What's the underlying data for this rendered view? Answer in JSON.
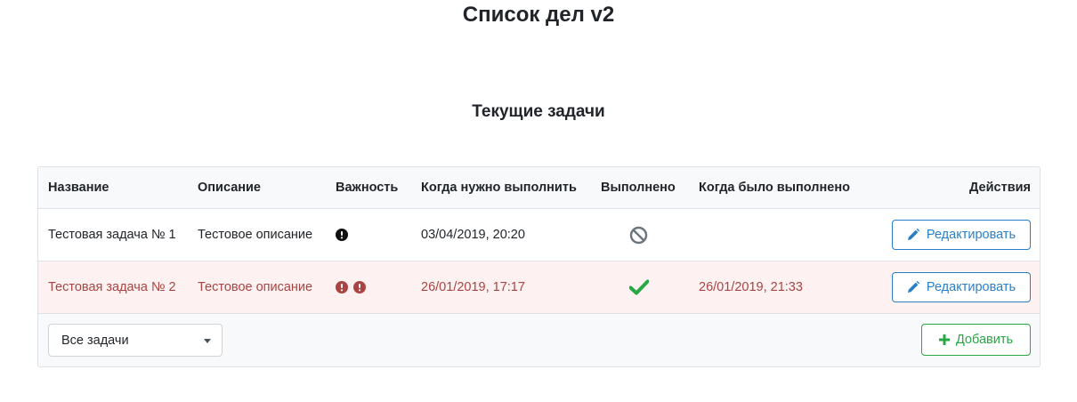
{
  "page": {
    "title": "Список дел v2",
    "section_title": "Текущие задачи"
  },
  "table": {
    "columns": {
      "name": "Название",
      "description": "Описание",
      "importance": "Важность",
      "due": "Когда нужно выполнить",
      "done": "Выполнено",
      "completed_at": "Когда было выполнено",
      "actions": "Действия"
    },
    "rows": [
      {
        "name": "Тестовая задача № 1",
        "description": "Тестовое описание",
        "importance_level": 1,
        "importance_icon": "exclamation-circle-icon",
        "due": "03/04/2019, 20:20",
        "done_icon": "ban-icon",
        "completed_at": "",
        "edit_label": "Редактировать"
      },
      {
        "name": "Тестовая задача № 2",
        "description": "Тестовое описание",
        "importance_level": 2,
        "importance_icon": "exclamation-circle-icon",
        "due": "26/01/2019, 17:17",
        "done_icon": "check-icon",
        "completed_at": "26/01/2019, 21:33",
        "edit_label": "Редактировать"
      }
    ]
  },
  "footer": {
    "filter_value": "Все задачи",
    "add_label": "Добавить"
  },
  "colors": {
    "primary": "#2a7fc9",
    "success": "#28a745",
    "danger_text": "#a94442",
    "danger_bg": "#fdf1f1",
    "muted_icon": "#6c757d"
  }
}
